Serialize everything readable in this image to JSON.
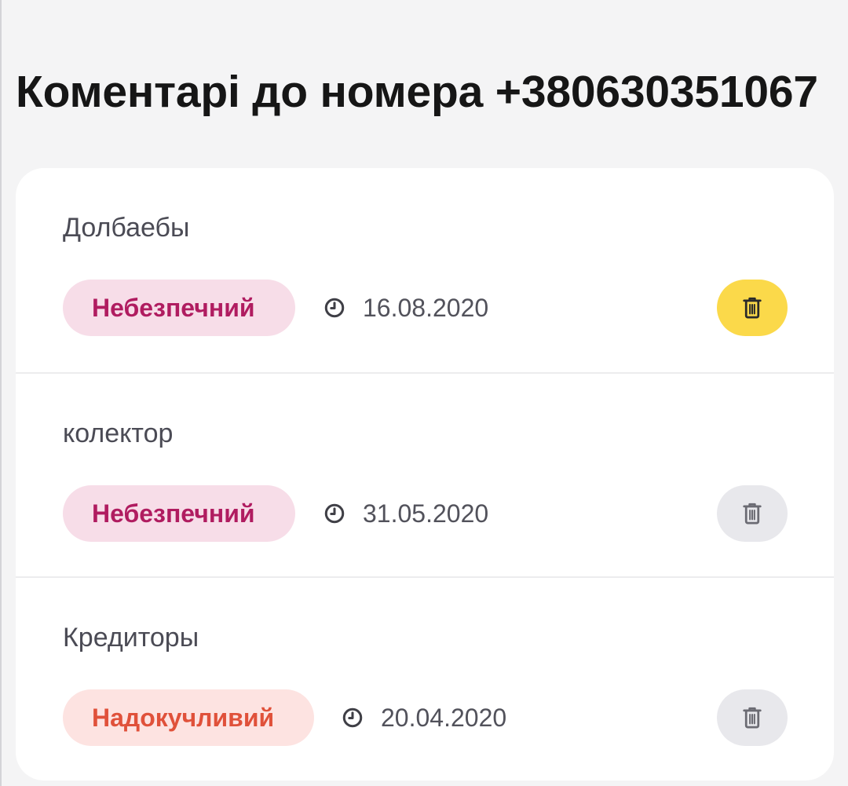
{
  "page": {
    "title": "Коментарі до номера +380630351067"
  },
  "comments": [
    {
      "text": "Долбаебы",
      "category": "Небезпечний",
      "category_color": "#b01c60",
      "category_bg": "#f7dde8",
      "date": "16.08.2020",
      "delete_icon": "trash-icon",
      "delete_state": "active",
      "delete_bg": "#fbd94a",
      "delete_icon_color": "#2a2a2a"
    },
    {
      "text": "колектор",
      "category": "Небезпечний",
      "category_color": "#b01c60",
      "category_bg": "#f7dde8",
      "date": "31.05.2020",
      "delete_icon": "trash-icon",
      "delete_state": "default",
      "delete_bg": "#e8e8ec",
      "delete_icon_color": "#6b6b73"
    },
    {
      "text": "Кредиторы",
      "category": "Надокучливий",
      "category_color": "#e0513a",
      "category_bg": "#fde3e1",
      "date": "20.04.2020",
      "delete_icon": "trash-icon",
      "delete_state": "default",
      "delete_bg": "#e8e8ec",
      "delete_icon_color": "#6b6b73"
    }
  ],
  "icons": {
    "date": "clock-icon",
    "delete": "trash-icon"
  },
  "colors": {
    "background": "#f4f4f5",
    "card": "#ffffff",
    "title": "#161616",
    "comment_text": "#4b4b55",
    "date_text": "#52525b",
    "divider": "#ececee"
  }
}
